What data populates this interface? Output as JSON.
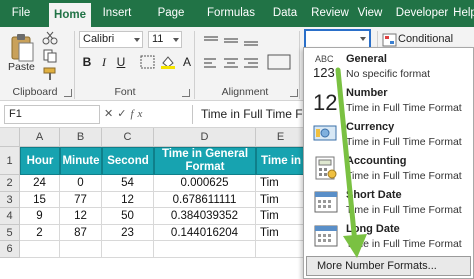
{
  "tabs": [
    "File",
    "Home",
    "Insert",
    "Page Layout",
    "Formulas",
    "Data",
    "Review",
    "View",
    "Developer",
    "Help"
  ],
  "ribbon": {
    "paste_label": "Paste",
    "clipboard_label": "Clipboard",
    "font_name": "Calibri",
    "font_size": "11",
    "bold": "B",
    "italic": "I",
    "underline": "U",
    "font_label": "Font",
    "alignment_label": "Alignment",
    "number_format_value": "",
    "conditional_formatting": "Conditional Formatting"
  },
  "formula_bar": {
    "name_box": "F1",
    "fx": "fx",
    "content": "Time in Full Time Format"
  },
  "sheet": {
    "columns": [
      "A",
      "B",
      "C",
      "D",
      "E"
    ],
    "rows": [
      "1",
      "2",
      "3",
      "4",
      "5",
      "6"
    ],
    "headers": [
      "Hour",
      "Minute",
      "Second",
      "Time in General Format",
      "Time in D"
    ],
    "data": [
      [
        "24",
        "0",
        "54",
        "0.000625",
        "Tim"
      ],
      [
        "15",
        "77",
        "12",
        "0.678611111",
        "Tim"
      ],
      [
        "9",
        "12",
        "50",
        "0.384039352",
        "Tim"
      ],
      [
        "2",
        "87",
        "23",
        "0.144016204",
        "Tim"
      ]
    ]
  },
  "number_format_menu": {
    "items": [
      {
        "title": "General",
        "subtitle": "No specific format",
        "icon": "abc-123-icon"
      },
      {
        "title": "Number",
        "subtitle": "Time in Full Time Format",
        "icon": "number-12-icon"
      },
      {
        "title": "Currency",
        "subtitle": "Time in Full Time Format",
        "icon": "currency-icon"
      },
      {
        "title": "Accounting",
        "subtitle": "Time in Full Time Format",
        "icon": "accounting-icon"
      },
      {
        "title": "Short Date",
        "subtitle": "Time in Full Time Format",
        "icon": "calendar-icon"
      },
      {
        "title": "Long Date",
        "subtitle": "Time in Full Time Format",
        "icon": "calendar-icon"
      }
    ],
    "more": "More Number Formats..."
  },
  "colors": {
    "ribbon_green": "#217346",
    "table_header": "#17a3b0",
    "annotation_arrow": "#7ac142",
    "selection_blue": "#2a6fc9"
  }
}
